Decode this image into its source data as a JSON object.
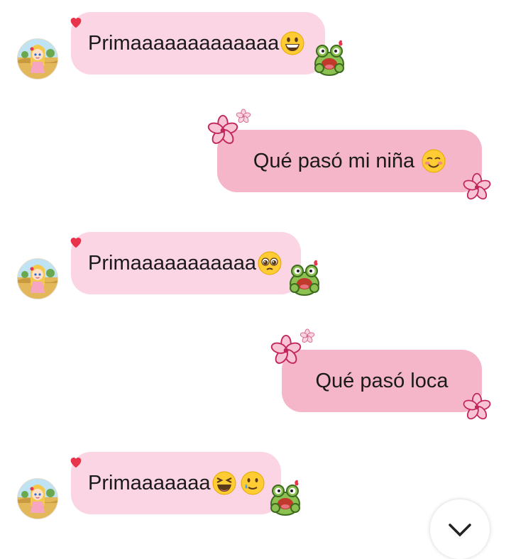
{
  "messages": [
    {
      "side": "in",
      "text": "Primaaaaaaaaaaaaa",
      "emojis": [
        "grinning-face"
      ]
    },
    {
      "side": "out",
      "text": "Qué pasó mi niña",
      "emojis": [
        "smiling-face"
      ]
    },
    {
      "side": "in",
      "text": "Primaaaaaaaaaaa",
      "emojis": [
        "pleading-face"
      ]
    },
    {
      "side": "out",
      "text": "Qué pasó loca",
      "emojis": []
    },
    {
      "side": "in",
      "text": "Primaaaaaaa",
      "emojis": [
        "laughing-squinting-face",
        "smiling-face-with-tear"
      ]
    }
  ],
  "colors": {
    "incoming_bubble": "#fbd5e3",
    "outgoing_bubble": "#f5b6c9",
    "heart": "#e8334a",
    "frog": "#8cc152",
    "flower": "#d6336c"
  }
}
